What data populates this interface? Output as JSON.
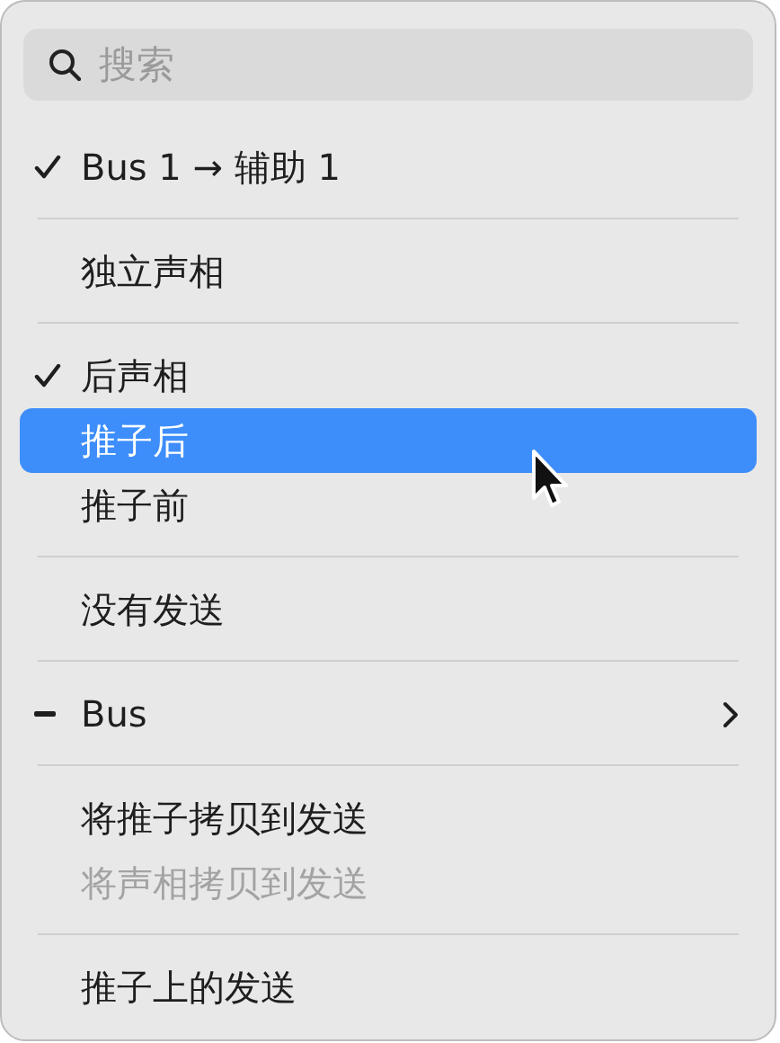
{
  "search": {
    "placeholder": "搜索"
  },
  "sections": [
    {
      "items": [
        {
          "label": "Bus 1 → 辅助 1",
          "checked": true,
          "mixed": false,
          "selected": false,
          "disabled": false,
          "submenu": false
        }
      ]
    },
    {
      "items": [
        {
          "label": "独立声相",
          "checked": false,
          "mixed": false,
          "selected": false,
          "disabled": false,
          "submenu": false
        }
      ]
    },
    {
      "items": [
        {
          "label": "后声相",
          "checked": true,
          "mixed": false,
          "selected": false,
          "disabled": false,
          "submenu": false
        },
        {
          "label": "推子后",
          "checked": false,
          "mixed": false,
          "selected": true,
          "disabled": false,
          "submenu": false
        },
        {
          "label": "推子前",
          "checked": false,
          "mixed": false,
          "selected": false,
          "disabled": false,
          "submenu": false
        }
      ]
    },
    {
      "items": [
        {
          "label": "没有发送",
          "checked": false,
          "mixed": false,
          "selected": false,
          "disabled": false,
          "submenu": false
        }
      ]
    },
    {
      "items": [
        {
          "label": "Bus",
          "checked": false,
          "mixed": true,
          "selected": false,
          "disabled": false,
          "submenu": true
        }
      ]
    },
    {
      "items": [
        {
          "label": "将推子拷贝到发送",
          "checked": false,
          "mixed": false,
          "selected": false,
          "disabled": false,
          "submenu": false
        },
        {
          "label": "将声相拷贝到发送",
          "checked": false,
          "mixed": false,
          "selected": false,
          "disabled": true,
          "submenu": false
        }
      ]
    },
    {
      "items": [
        {
          "label": "推子上的发送",
          "checked": false,
          "mixed": false,
          "selected": false,
          "disabled": false,
          "submenu": false
        }
      ]
    }
  ]
}
